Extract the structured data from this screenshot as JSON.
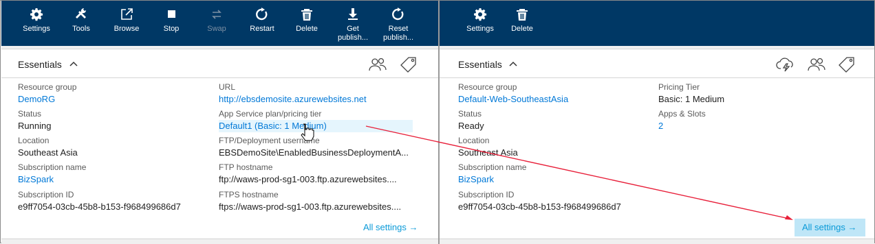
{
  "left_toolbar": {
    "buttons": [
      {
        "label": "Settings",
        "icon": "gear-icon"
      },
      {
        "label": "Tools",
        "icon": "tools-icon"
      },
      {
        "label": "Browse",
        "icon": "external-link-icon"
      },
      {
        "label": "Stop",
        "icon": "stop-icon"
      },
      {
        "label": "Swap",
        "icon": "swap-icon",
        "disabled": true
      },
      {
        "label": "Restart",
        "icon": "restart-icon"
      },
      {
        "label": "Delete",
        "icon": "trash-icon"
      },
      {
        "label": "Get publish...",
        "label_lines": [
          "Get",
          "publish..."
        ],
        "icon": "download-icon"
      },
      {
        "label": "Reset publish...",
        "label_lines": [
          "Reset",
          "publish..."
        ],
        "icon": "reset-icon"
      }
    ]
  },
  "right_toolbar": {
    "buttons": [
      {
        "label": "Settings",
        "icon": "gear-icon"
      },
      {
        "label": "Delete",
        "icon": "trash-icon"
      }
    ]
  },
  "left_panel": {
    "essentials_title": "Essentials",
    "header_icons": [
      "users-icon",
      "tag-icon"
    ],
    "fields": {
      "resource_group": {
        "label": "Resource group",
        "value": "DemoRG"
      },
      "status": {
        "label": "Status",
        "value": "Running"
      },
      "location": {
        "label": "Location",
        "value": "Southeast Asia"
      },
      "subscription_name": {
        "label": "Subscription name",
        "value": "BizSpark"
      },
      "subscription_id": {
        "label": "Subscription ID",
        "value": "e9ff7054-03cb-45b8-b153-f968499686d7"
      },
      "url": {
        "label": "URL",
        "value": "http://ebsdemosite.azurewebsites.net"
      },
      "app_service_plan": {
        "label": "App Service plan/pricing tier",
        "value": "Default1 (Basic: 1 Medium)"
      },
      "ftp_user": {
        "label": "FTP/Deployment username",
        "value": "EBSDemoSite\\EnabledBusinessDeploymentA..."
      },
      "ftp_host": {
        "label": "FTP hostname",
        "value": "ftp://waws-prod-sg1-003.ftp.azurewebsites...."
      },
      "ftps_host": {
        "label": "FTPS hostname",
        "value": "ftps://waws-prod-sg1-003.ftp.azurewebsites...."
      }
    },
    "all_settings": "All settings →"
  },
  "right_panel": {
    "essentials_title": "Essentials",
    "header_icons": [
      "cloud-lightning-icon",
      "users-icon",
      "tag-icon"
    ],
    "fields": {
      "resource_group": {
        "label": "Resource group",
        "value": "Default-Web-SoutheastAsia"
      },
      "status": {
        "label": "Status",
        "value": "Ready"
      },
      "location": {
        "label": "Location",
        "value": "Southeast Asia"
      },
      "subscription_name": {
        "label": "Subscription name",
        "value": "BizSpark"
      },
      "subscription_id": {
        "label": "Subscription ID",
        "value": "e9ff7054-03cb-45b8-b153-f968499686d7"
      },
      "pricing_tier": {
        "label": "Pricing Tier",
        "value": "Basic: 1 Medium"
      },
      "apps_slots": {
        "label": "Apps & Slots",
        "value": "2"
      }
    },
    "all_settings": "All settings →"
  },
  "colors": {
    "toolbar_bg": "#003865",
    "link": "#0078d7",
    "all_settings": "#0a9ad8",
    "highlight": "#e5f5fd",
    "annotation_arrow": "#e8203a"
  }
}
